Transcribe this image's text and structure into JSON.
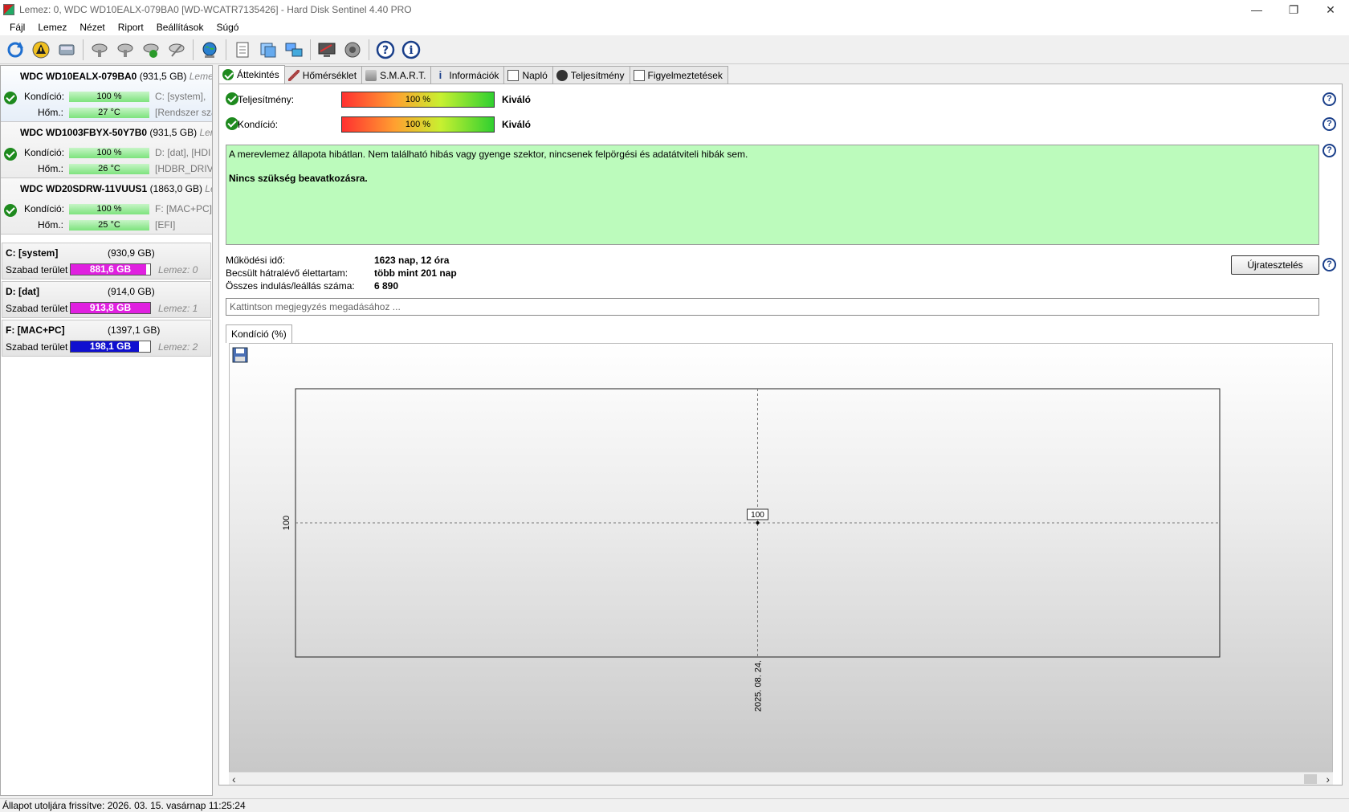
{
  "window": {
    "title": "Lemez: 0, WDC WD10EALX-079BA0 [WD-WCATR7135426]  -  Hard Disk Sentinel 4.40 PRO",
    "minimize": "—",
    "restore": "❐",
    "close": "✕"
  },
  "menu": [
    "Fájl",
    "Lemez",
    "Nézet",
    "Riport",
    "Beállítások",
    "Súgó"
  ],
  "toolbar": {
    "icons": [
      "refresh-icon",
      "alert-icon",
      "disk-icon",
      "disk-test-icon",
      "disk-test2-icon",
      "disk-check-icon",
      "disk-tool-icon",
      "globe-icon",
      "report-icon",
      "transfer-icon",
      "network-icon",
      "monitor-icon",
      "speaker-icon",
      "help-icon",
      "info-icon"
    ]
  },
  "disks": [
    {
      "name": "WDC WD10EALX-079BA0",
      "size": "(931,5 GB)",
      "tag": "Lemez:",
      "health_label": "Kondíció:",
      "health": "100 %",
      "volumes": "C: [system],",
      "temp_label": "Hőm.:",
      "temp": "27 °C",
      "extra": "[Rendszer szá"
    },
    {
      "name": "WDC WD1003FBYX-50Y7B0",
      "size": "(931,5 GB)",
      "tag": "Lem",
      "health_label": "Kondíció:",
      "health": "100 %",
      "volumes": "D: [dat],  [HDI",
      "temp_label": "Hőm.:",
      "temp": "26 °C",
      "extra": "[HDBR_DRIVE"
    },
    {
      "name": "WDC WD20SDRW-11VUUS1",
      "size": "(1863,0 GB)",
      "tag": "Le",
      "health_label": "Kondíció:",
      "health": "100 %",
      "volumes": "F: [MAC+PC],",
      "temp_label": "Hőm.:",
      "temp": "25 °C",
      "extra": "[EFI]"
    }
  ],
  "volumes": [
    {
      "name": "C: [system]",
      "size": "(930,9 GB)",
      "free_label": "Szabad terület",
      "free": "881,6 GB",
      "disk": "Lemez: 0",
      "fill": 0.95,
      "color": "#e020e0"
    },
    {
      "name": "D: [dat]",
      "size": "(914,0 GB)",
      "free_label": "Szabad terület",
      "free": "913,8 GB",
      "disk": "Lemez: 1",
      "fill": 1.0,
      "color": "#e020e0"
    },
    {
      "name": "F: [MAC+PC]",
      "size": "(1397,1 GB)",
      "free_label": "Szabad terület",
      "free": "198,1 GB",
      "disk": "Lemez: 2",
      "fill": 0.86,
      "color": "#1010d0"
    }
  ],
  "tabs": [
    "Áttekintés",
    "Hőmérséklet",
    "S.M.A.R.T.",
    "Információk",
    "Napló",
    "Teljesítmény",
    "Figyelmeztetések"
  ],
  "overview": {
    "performance_label": "Teljesítmény:",
    "performance_value": "100 %",
    "performance_rating": "Kiváló",
    "health_label": "Kondíció:",
    "health_value": "100 %",
    "health_rating": "Kiváló",
    "status_message": "A merevlemez állapota hibátlan. Nem található hibás vagy gyenge szektor, nincsenek felpörgési és adatátviteli hibák sem.",
    "status_action": "Nincs szükség beavatkozásra.",
    "uptime_label": "Működési idő:",
    "uptime_value": "1623 nap, 12 óra",
    "lifetime_label": "Becsült hátralévő élettartam:",
    "lifetime_value": "több mint 201 nap",
    "starts_label": "Összes indulás/leállás száma:",
    "starts_value": "6 890",
    "retest_button": "Újratesztelés",
    "note_placeholder": "Kattintson megjegyzés megadásához ...",
    "chart_tab": "Kondíció  (%)"
  },
  "chart_data": {
    "type": "line",
    "x": [
      "2025. 08. 24."
    ],
    "values": [
      100
    ],
    "data_labels": [
      "100"
    ],
    "ytick": "100",
    "xtick": "2025. 08. 24.",
    "grid": true
  },
  "statusbar": "Állapot utoljára frissítve: 2026. 03. 15. vasárnap 11:25:24"
}
